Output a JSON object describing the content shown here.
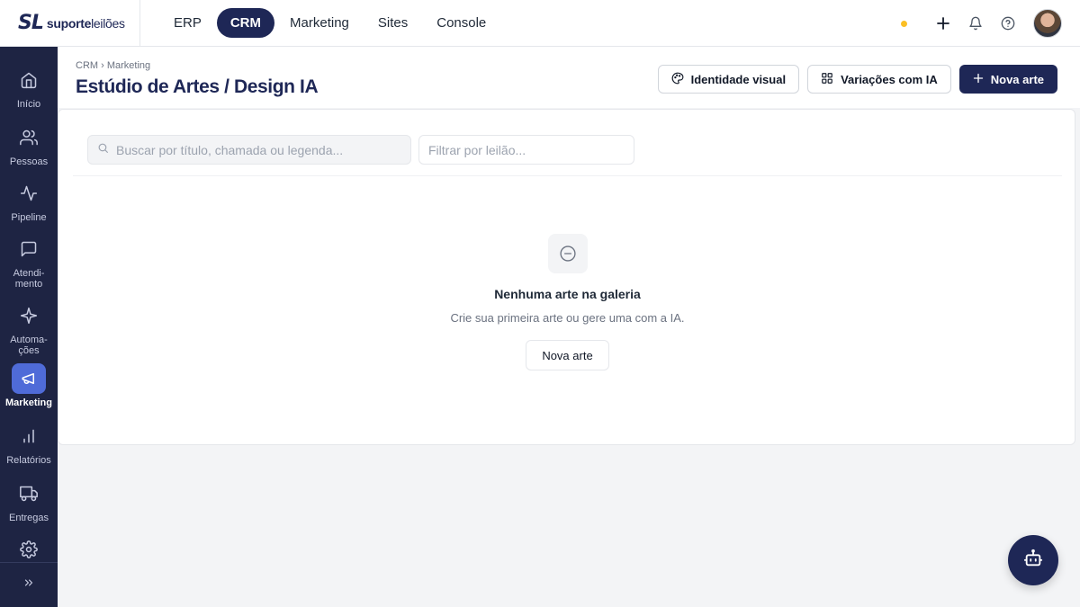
{
  "brand": {
    "mark": "SL",
    "name_bold": "suporte",
    "name_light": "leilões"
  },
  "topnav": [
    {
      "label": "ERP",
      "active": false
    },
    {
      "label": "CRM",
      "active": true
    },
    {
      "label": "Marketing",
      "active": false
    },
    {
      "label": "Sites",
      "active": false
    },
    {
      "label": "Console",
      "active": false
    }
  ],
  "topbar_icons": [
    "status-dot",
    "plus-icon",
    "bell-icon",
    "help-icon",
    "avatar"
  ],
  "sidebar": {
    "items": [
      {
        "label": "Início",
        "icon": "home-icon"
      },
      {
        "label": "Pessoas",
        "icon": "users-icon"
      },
      {
        "label": "Pipeline",
        "icon": "activity-icon"
      },
      {
        "label": "Atendi-\nmento",
        "icon": "message-icon"
      },
      {
        "label": "Automa-\nções",
        "icon": "sparkle-icon"
      },
      {
        "label": "Marketing",
        "icon": "megaphone-icon",
        "active": true
      },
      {
        "label": "Relatórios",
        "icon": "bar-chart-icon"
      },
      {
        "label": "Entregas",
        "icon": "truck-icon"
      },
      {
        "label": "",
        "icon": "gear-icon"
      }
    ],
    "expand_icon": "chevrons-right-icon"
  },
  "header": {
    "breadcrumb": "CRM › Marketing",
    "title": "Estúdio de Artes / Design IA",
    "actions": {
      "identity": "Identidade visual",
      "variations": "Variações com IA",
      "new": "Nova arte"
    }
  },
  "filters": {
    "search_placeholder": "Buscar por título, chamada ou legenda...",
    "auction_placeholder": "Filtrar por leilão..."
  },
  "empty_state": {
    "title": "Nenhuma arte na galeria",
    "subtitle": "Crie sua primeira arte ou gere uma com a IA.",
    "button": "Nova arte"
  },
  "colors": {
    "primary": "#1e2756",
    "sidebar": "#1e2443",
    "active_item": "#4f6bd8",
    "status_dot": "#fbbf24"
  }
}
